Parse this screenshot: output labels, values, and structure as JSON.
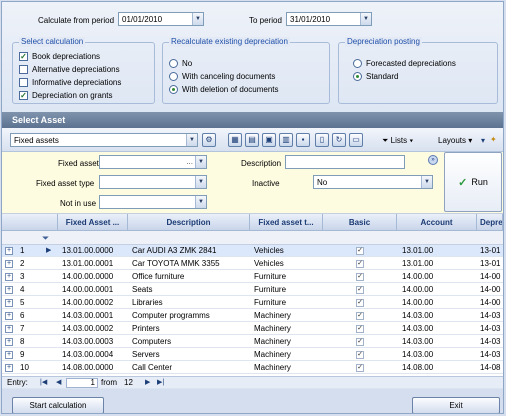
{
  "period": {
    "from_label": "Calculate from period",
    "from_value": "01/01/2010",
    "to_label": "To period",
    "to_value": "31/01/2010"
  },
  "select_calc": {
    "title": "Select calculation",
    "items": [
      {
        "label": "Book depreciations",
        "checked": true
      },
      {
        "label": "Alternative depreciations",
        "checked": false
      },
      {
        "label": "Informative depreciations",
        "checked": false
      },
      {
        "label": "Depreciation on grants",
        "checked": true
      }
    ]
  },
  "recalc": {
    "title": "Recalculate existing depreciation",
    "items": [
      {
        "label": "No",
        "selected": false
      },
      {
        "label": "With canceling documents",
        "selected": false
      },
      {
        "label": "With deletion of documents",
        "selected": true
      }
    ]
  },
  "posting": {
    "title": "Depreciation posting",
    "items": [
      {
        "label": "Forecasted depreciations",
        "selected": false
      },
      {
        "label": "Standard",
        "selected": true
      }
    ]
  },
  "select_asset_header": "Select Asset",
  "toolbar": {
    "view_value": "Fixed assets",
    "lists_label": "Lists",
    "layouts_label": "Layouts",
    "check_mark": "✓"
  },
  "filter": {
    "fixed_asset_label": "Fixed asset",
    "fixed_asset_type_label": "Fixed asset type",
    "not_in_use_label": "Not in use",
    "description_label": "Description",
    "inactive_label": "Inactive",
    "inactive_value": "No",
    "ellipsis": "...",
    "run_label": "Run"
  },
  "grid": {
    "headers": [
      "Fixed Asset ...",
      "Description",
      "Fixed asset t...",
      "Basic",
      "Account",
      "Depre"
    ],
    "rows": [
      {
        "n": "1",
        "code": "13.01.00.0000",
        "desc": "Car AUDI A3 ZMK 2841",
        "type": "Vehicles",
        "acc": "13.01.00",
        "dep": "13-01"
      },
      {
        "n": "2",
        "code": "13.01.00.0001",
        "desc": "Car TOYOTA MMK 3355",
        "type": "Vehicles",
        "acc": "13.01.00",
        "dep": "13-01"
      },
      {
        "n": "3",
        "code": "14.00.00.0000",
        "desc": "Office furniture",
        "type": "Furniture",
        "acc": "14.00.00",
        "dep": "14-00"
      },
      {
        "n": "4",
        "code": "14.00.00.0001",
        "desc": "Seats",
        "type": "Furniture",
        "acc": "14.00.00",
        "dep": "14-00"
      },
      {
        "n": "5",
        "code": "14.00.00.0002",
        "desc": "Libraries",
        "type": "Furniture",
        "acc": "14.00.00",
        "dep": "14-00"
      },
      {
        "n": "6",
        "code": "14.03.00.0001",
        "desc": "Computer programms",
        "type": "Machinery",
        "acc": "14.03.00",
        "dep": "14-03"
      },
      {
        "n": "7",
        "code": "14.03.00.0002",
        "desc": "Printers",
        "type": "Machinery",
        "acc": "14.03.00",
        "dep": "14-03"
      },
      {
        "n": "8",
        "code": "14.03.00.0003",
        "desc": "Computers",
        "type": "Machinery",
        "acc": "14.03.00",
        "dep": "14-03"
      },
      {
        "n": "9",
        "code": "14.03.00.0004",
        "desc": "Servers",
        "type": "Machinery",
        "acc": "14.03.00",
        "dep": "14-03"
      },
      {
        "n": "10",
        "code": "14.08.00.0000",
        "desc": "Call Center",
        "type": "Machinery",
        "acc": "14.08.00",
        "dep": "14-08"
      }
    ]
  },
  "nav": {
    "entry_label": "Entry:",
    "current": "1",
    "from_label": "from",
    "total": "12"
  },
  "buttons": {
    "start": "Start calculation",
    "exit": "Exit"
  }
}
